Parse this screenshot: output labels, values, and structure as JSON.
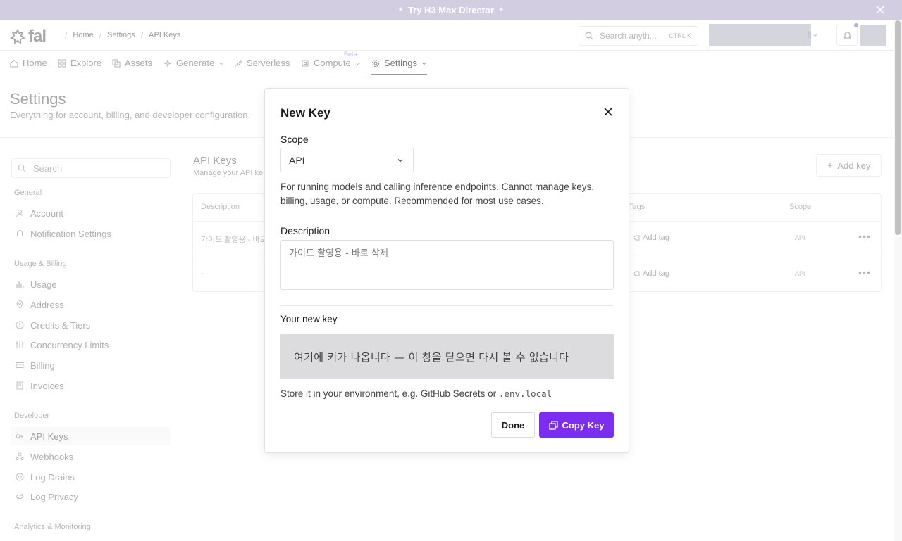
{
  "banner": {
    "text": "Try H3 Max Director"
  },
  "topbar": {
    "logo": "fal",
    "breadcrumbs": [
      "Home",
      "Settings",
      "API Keys"
    ],
    "search_placeholder": "Search anyth...",
    "search_shortcut": "CTRL K"
  },
  "nav": {
    "items": [
      {
        "label": "Home",
        "icon": "home-icon"
      },
      {
        "label": "Explore",
        "icon": "grid-icon"
      },
      {
        "label": "Assets",
        "icon": "copy-icon"
      },
      {
        "label": "Generate",
        "icon": "sparkle-icon"
      },
      {
        "label": "Serverless",
        "icon": "rocket-icon"
      },
      {
        "label": "Compute",
        "icon": "cpu-icon"
      },
      {
        "label": "Settings",
        "icon": "gear-icon"
      }
    ],
    "beta_badge": "Beta",
    "active": "Settings"
  },
  "page": {
    "title": "Settings",
    "subtitle": "Everything for account, billing, and developer configuration."
  },
  "sidebar": {
    "search_placeholder": "Search",
    "groups": [
      {
        "label": "General",
        "items": [
          "Account",
          "Notification Settings"
        ]
      },
      {
        "label": "Usage & Billing",
        "items": [
          "Usage",
          "Address",
          "Credits & Tiers",
          "Concurrency Limits",
          "Billing",
          "Invoices"
        ]
      },
      {
        "label": "Developer",
        "items": [
          "API Keys",
          "Webhooks",
          "Log Drains",
          "Log Privacy"
        ]
      },
      {
        "label": "Analytics & Monitoring",
        "items": []
      }
    ],
    "active": "API Keys"
  },
  "api_keys_panel": {
    "title": "API Keys",
    "subtitle": "Manage your API ke",
    "add_key_label": "Add key",
    "columns": [
      "Description",
      "Tags",
      "Scope"
    ],
    "rows": [
      {
        "description": "가이드 촬영용 - 바로",
        "tag_action": "Add tag",
        "scope": "API"
      },
      {
        "description": "-",
        "tag_action": "Add tag",
        "scope": "API"
      }
    ]
  },
  "modal": {
    "title": "New Key",
    "scope_label": "Scope",
    "scope_value": "API",
    "scope_description": "For running models and calling inference endpoints. Cannot manage keys, billing, usage, or compute. Recommended for most use cases.",
    "description_label": "Description",
    "description_value": "가이드 촬영용 - 바로 삭제",
    "new_key_label": "Your new key",
    "new_key_value": "여기에 키가 나옵니다 — 이 창을 닫으면 다시 볼 수 없습니다",
    "store_text": "Store it in your environment, e.g. GitHub Secrets or",
    "store_code": ".env.local",
    "done_label": "Done",
    "copy_label": "Copy Key"
  },
  "colors": {
    "banner": "#d3cde2",
    "primary_button": "#7c2df0",
    "key_box": "#dcdcdf"
  }
}
